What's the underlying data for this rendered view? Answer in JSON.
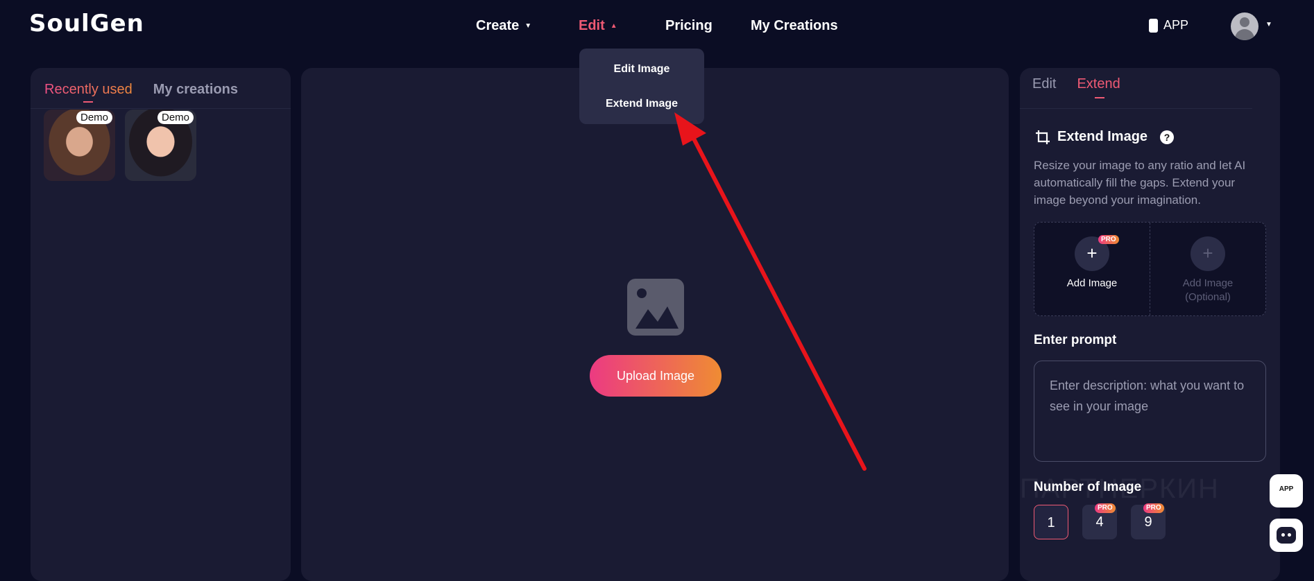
{
  "header": {
    "logo": "SoulGen",
    "nav": {
      "create": "Create",
      "edit": "Edit",
      "pricing": "Pricing",
      "my_creations": "My Creations"
    },
    "app_label": "APP"
  },
  "edit_dropdown": {
    "items": [
      "Edit Image",
      "Extend Image"
    ]
  },
  "left_panel": {
    "tabs": [
      "Recently used",
      "My creations"
    ],
    "thumb_badge": "Demo"
  },
  "center_panel": {
    "upload_label": "Upload Image"
  },
  "right_panel": {
    "tabs": [
      "Edit",
      "Extend"
    ],
    "title": "Extend Image",
    "help": "?",
    "description": "Resize your image to any ratio and let AI automatically fill the gaps. Extend your image beyond your imagination.",
    "add_image": "Add Image",
    "add_image_optional": "Add Image\n(Optional)",
    "pro_badge": "PRO",
    "prompt_title": "Enter prompt",
    "prompt_placeholder": "Enter description: what you want to see in your image",
    "num_title": "Number of Image",
    "num_options": [
      "1",
      "4",
      "9"
    ]
  },
  "floating": {
    "app_label": "APP"
  },
  "watermark": "ПАРТНЕРКИН",
  "colors": {
    "background": "#0b0d24",
    "panel": "#1a1b33",
    "accent": "#ef5a74",
    "gradient_start": "#ec3a82",
    "gradient_end": "#ef8c33",
    "annotation_arrow": "#e8141b"
  }
}
